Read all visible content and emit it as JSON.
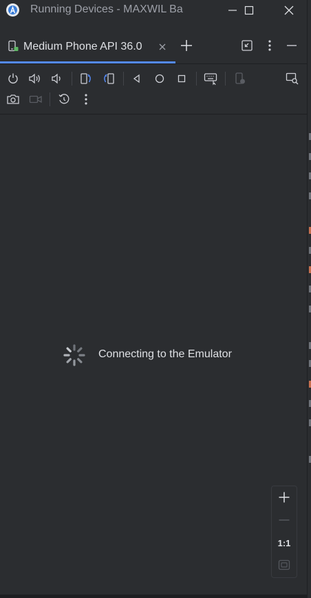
{
  "window": {
    "title": "Running Devices - MAXWIL Ba"
  },
  "tab": {
    "label": "Medium Phone API 36.0"
  },
  "status": {
    "message": "Connecting to the Emulator"
  },
  "zoom": {
    "actual_size_label": "1:1"
  },
  "colors": {
    "accent": "#548af7",
    "background": "#2b2d30",
    "text": "#dfe1e5"
  }
}
